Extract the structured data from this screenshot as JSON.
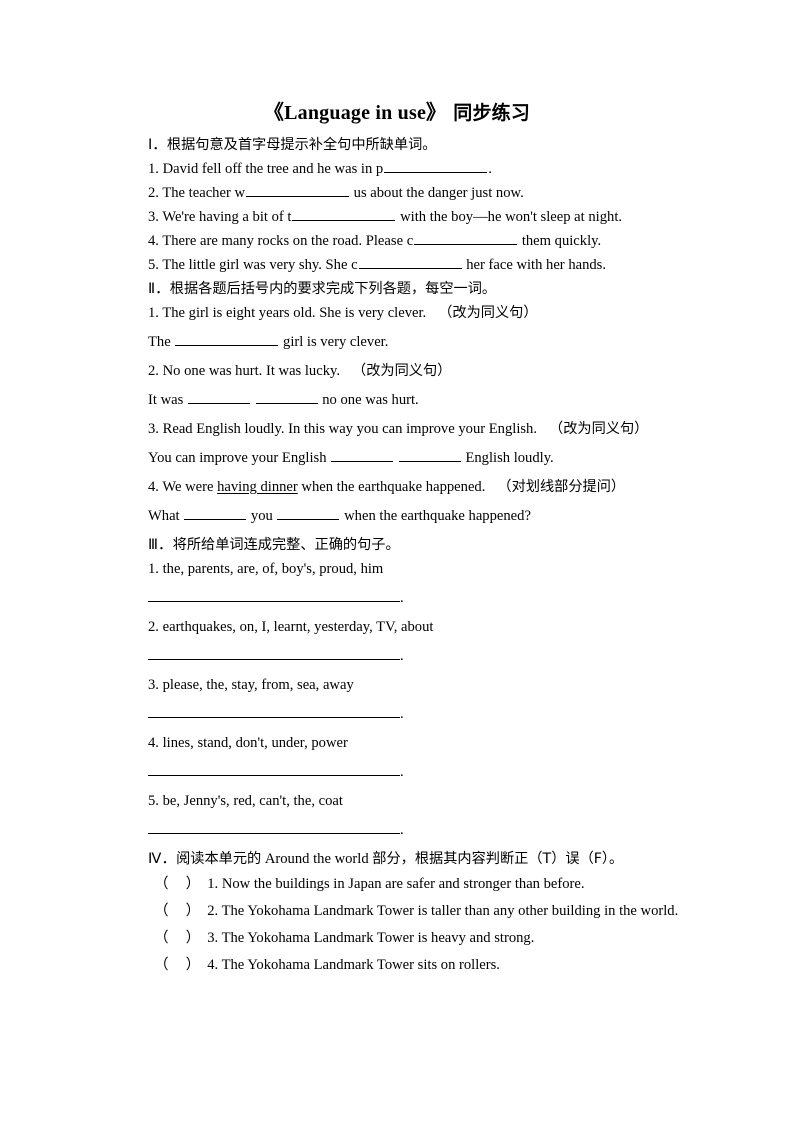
{
  "document": {
    "title_main": "《Language in use》",
    "title_suffix": "同步练习"
  },
  "sections": {
    "section1": {
      "heading_number": "Ⅰ．",
      "heading_text": "根据句意及首字母提示补全句中所缺单词。",
      "items": [
        {
          "number": "1.",
          "before": "David fell off the tree and he was in p",
          "after": "."
        },
        {
          "number": "2.",
          "before": "The teacher w",
          "after": "us about the danger just now."
        },
        {
          "number": "3.",
          "before": "We're having a bit of t",
          "after": "with the boy—he won't sleep at night."
        },
        {
          "number": "4.",
          "before": "There are many rocks on the road. Please c",
          "after": "them quickly."
        },
        {
          "number": "5.",
          "before": "The little girl was very shy. She c",
          "after": "her face with her hands."
        }
      ]
    },
    "section2": {
      "heading_number": "Ⅱ．",
      "heading_text": "根据各题后括号内的要求完成下列各题，每空一词。",
      "items": [
        {
          "number": "1.",
          "prompt": "The girl is eight years old. She is very clever.",
          "instruction": "（改为同义句）",
          "answer_before": "The",
          "answer_after": "girl is very clever."
        },
        {
          "number": "2.",
          "prompt": "No one was hurt. It was lucky.",
          "instruction": "（改为同义句）",
          "answer_before": "It was",
          "answer_mid": "",
          "answer_after": "no one was hurt."
        },
        {
          "number": "3.",
          "prompt": "Read English loudly. In this way you can improve your English.",
          "instruction": "（改为同义句）",
          "answer_before": "You can improve your English",
          "answer_mid": "",
          "answer_after": "English loudly."
        },
        {
          "number": "4.",
          "prompt_before": "We were",
          "prompt_underlined": "having dinner",
          "prompt_after": "when the earthquake happened.",
          "instruction": "（对划线部分提问）",
          "answer_before": "What",
          "answer_mid": "you",
          "answer_after": "when the earthquake happened?"
        }
      ]
    },
    "section3": {
      "heading_number": "Ⅲ．",
      "heading_text": "将所给单词连成完整、正确的句子。",
      "items": [
        {
          "number": "1.",
          "words": "the, parents, are, of, boy's, proud, him",
          "end_mark": "."
        },
        {
          "number": "2.",
          "words": "earthquakes, on, I, learnt, yesterday, TV, about",
          "end_mark": "."
        },
        {
          "number": "3.",
          "words": "please, the, stay, from, sea, away",
          "end_mark": "."
        },
        {
          "number": "4.",
          "words": "lines, stand, don't, under, power",
          "end_mark": "."
        },
        {
          "number": "5.",
          "words": "be, Jenny's, red, can't, the, coat",
          "end_mark": "."
        }
      ]
    },
    "section4": {
      "heading_number": "Ⅳ．",
      "heading_text_a": "阅读本单元的",
      "heading_en": "Around the world",
      "heading_text_b": "部分，根据其内容判断正（T）误（F）。",
      "items": [
        {
          "number": "1.",
          "text": "Now the buildings in Japan are safer and stronger than before."
        },
        {
          "number": "2.",
          "text": "The Yokohama Landmark Tower is taller than any other building in the world."
        },
        {
          "number": "3.",
          "text": "The Yokohama Landmark Tower is heavy and strong."
        },
        {
          "number": "4.",
          "text": "The Yokohama Landmark Tower sits on rollers."
        }
      ]
    }
  }
}
